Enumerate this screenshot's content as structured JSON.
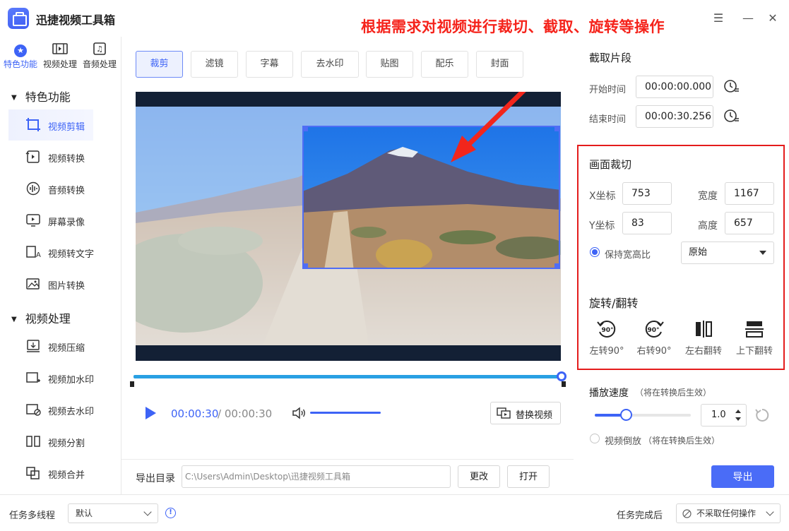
{
  "app": {
    "title": "迅捷视频工具箱"
  },
  "annotation": "根据需求对视频进行裁切、截取、旋转等操作",
  "window_controls": {
    "menu_glyph": "☰",
    "minimize_glyph": "—",
    "close_glyph": "✕"
  },
  "sidebar": {
    "top_categories": [
      {
        "label": "特色功能",
        "icon": "star-icon",
        "active": true
      },
      {
        "label": "视频处理",
        "icon": "film-icon",
        "active": false
      },
      {
        "label": "音频处理",
        "icon": "music-icon",
        "active": false
      }
    ],
    "sections": [
      {
        "title": "特色功能",
        "items": [
          "视频剪辑",
          "视频转换",
          "音频转换",
          "屏幕录像",
          "视频转文字",
          "图片转换"
        ]
      },
      {
        "title": "视频处理",
        "items": [
          "视频压缩",
          "视频加水印",
          "视频去水印",
          "视频分割",
          "视频合并"
        ]
      }
    ],
    "active_item": "视频剪辑"
  },
  "tabs": [
    "裁剪",
    "滤镜",
    "字幕",
    "去水印",
    "贴图",
    "配乐",
    "封面"
  ],
  "active_tab": "裁剪",
  "player": {
    "current_time": "00:00:30",
    "total_time": "/ 00:00:30",
    "progress": 1.0,
    "replace_video_label": "替换视频"
  },
  "clip_segment": {
    "title": "截取片段",
    "start_label": "开始时间",
    "start_value": "00:00:00.000",
    "end_label": "结束时间",
    "end_value": "00:00:30.256"
  },
  "crop": {
    "title": "画面裁切",
    "x_label": "X坐标",
    "x_value": "753",
    "width_label": "宽度",
    "width_value": "1167",
    "y_label": "Y坐标",
    "y_value": "83",
    "height_label": "高度",
    "height_value": "657",
    "keep_ratio_label": "保持宽高比",
    "keep_ratio_checked": true,
    "ratio_value": "原始"
  },
  "rotate": {
    "title": "旋转/翻转",
    "items": [
      {
        "label": "左转90°",
        "icon": "rotate-left-90-icon",
        "badge": "90°"
      },
      {
        "label": "右转90°",
        "icon": "rotate-right-90-icon",
        "badge": "90°"
      },
      {
        "label": "左右翻转",
        "icon": "flip-horizontal-icon"
      },
      {
        "label": "上下翻转",
        "icon": "flip-vertical-icon"
      }
    ]
  },
  "speed": {
    "label": "播放速度",
    "note": "（将在转换后生效）",
    "value": "1.0",
    "slider_fraction": 0.3
  },
  "reverse": {
    "label": "视频倒放",
    "note": "（将在转换后生效）",
    "checked": false
  },
  "export": {
    "dir_label": "导出目录",
    "path": "C:\\Users\\Admin\\Desktop\\迅捷视频工具箱",
    "change_label": "更改",
    "open_label": "打开",
    "export_label": "导出"
  },
  "status_bar": {
    "multithread_label": "任务多线程",
    "multithread_value": "默认",
    "info_glyph": "!",
    "after_task_label": "任务完成后",
    "after_task_value": "不采取任何操作"
  },
  "colors": {
    "accent": "#3d63f6",
    "annotation": "#f5231b",
    "highlight_frame": "#e41c1c",
    "preview_bg": "#132035"
  }
}
